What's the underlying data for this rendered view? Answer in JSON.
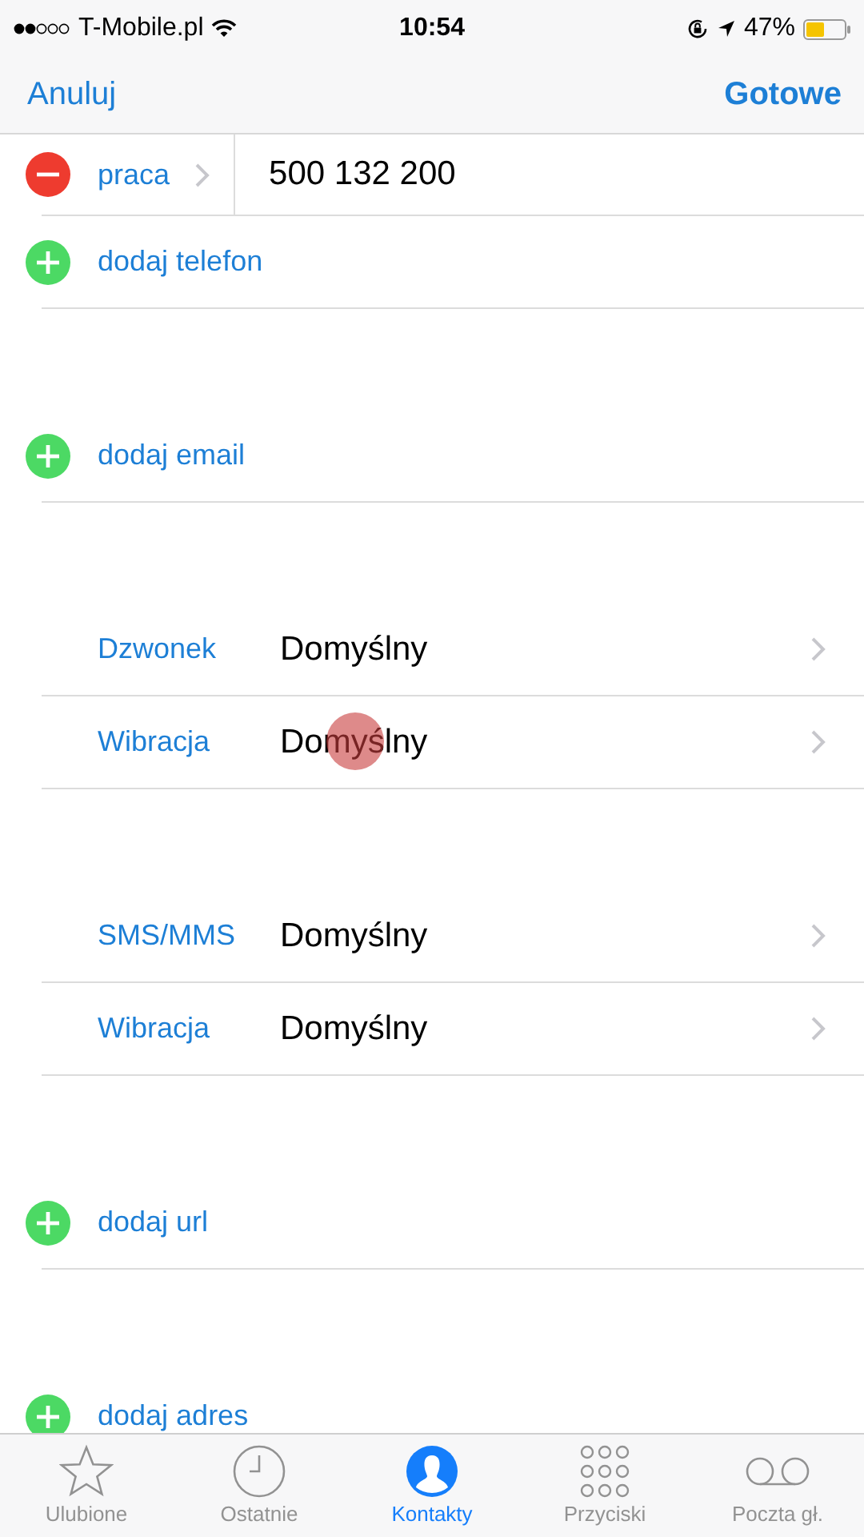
{
  "status_bar": {
    "carrier": "T-Mobile.pl",
    "time": "10:54",
    "battery": "47%"
  },
  "nav": {
    "cancel": "Anuluj",
    "done": "Gotowe"
  },
  "sections": [
    {
      "rows": [
        {
          "kind": "phone",
          "label": "praca",
          "value": "500 132 200"
        },
        {
          "kind": "add",
          "label": "dodaj telefon"
        }
      ]
    },
    {
      "rows": [
        {
          "kind": "add",
          "label": "dodaj email"
        }
      ]
    },
    {
      "rows": [
        {
          "kind": "setting",
          "label": "Dzwonek",
          "value": "Domyślny",
          "touched": false
        },
        {
          "kind": "setting",
          "label": "Wibracja",
          "value": "Domyślny",
          "touched": true
        }
      ]
    },
    {
      "rows": [
        {
          "kind": "setting",
          "label": "SMS/MMS",
          "value": "Domyślny",
          "touched": false
        },
        {
          "kind": "setting",
          "label": "Wibracja",
          "value": "Domyślny",
          "touched": false
        }
      ]
    },
    {
      "rows": [
        {
          "kind": "add",
          "label": "dodaj url"
        }
      ]
    },
    {
      "rows": [
        {
          "kind": "add",
          "label": "dodaj adres"
        }
      ]
    }
  ],
  "tabs": [
    {
      "kind": "star",
      "label": "Ulubione",
      "selected": false
    },
    {
      "kind": "clock",
      "label": "Ostatnie",
      "selected": false
    },
    {
      "kind": "person",
      "label": "Kontakty",
      "selected": true
    },
    {
      "kind": "keypad",
      "label": "Przyciski",
      "selected": false
    },
    {
      "kind": "voicemail",
      "label": "Poczta gł.",
      "selected": false
    }
  ]
}
